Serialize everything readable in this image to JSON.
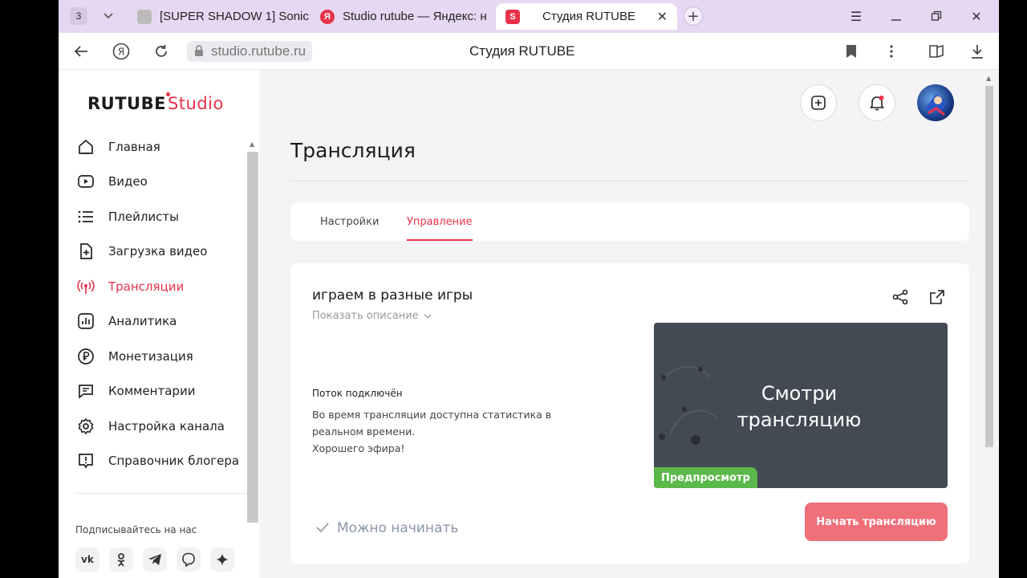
{
  "browser": {
    "tab_count": "3",
    "tabs": [
      {
        "label": "[SUPER SHADOW 1] Sonic"
      },
      {
        "label": "Studio rutube — Яндекс: н"
      },
      {
        "label": "Студия RUTUBE"
      }
    ],
    "url": "studio.rutube.ru",
    "page_title": "Студия RUTUBE"
  },
  "logo": {
    "brand": "RUTUBE",
    "suffix": "Studio"
  },
  "sidebar": {
    "items": [
      {
        "label": "Главная"
      },
      {
        "label": "Видео"
      },
      {
        "label": "Плейлисты"
      },
      {
        "label": "Загрузка видео"
      },
      {
        "label": "Трансляции"
      },
      {
        "label": "Аналитика"
      },
      {
        "label": "Монетизация"
      },
      {
        "label": "Комментарии"
      },
      {
        "label": "Настройка канала"
      },
      {
        "label": "Справочник блогера"
      }
    ],
    "follow_label": "Подписывайтесь на нас",
    "social": [
      "vk",
      "ok",
      "telegram",
      "viber",
      "dzen"
    ]
  },
  "main": {
    "title": "Трансляция",
    "tabs": [
      {
        "label": "Настройки"
      },
      {
        "label": "Управление"
      }
    ],
    "stream": {
      "title": "играем в разные игры",
      "show_description": "Показать описание",
      "status_heading": "Поток подключён",
      "info_line1": "Во время трансляции доступна статистика в",
      "info_line2": "реальном времени.",
      "info_line3": "Хорошего эфира!",
      "preview_line1": "Смотри",
      "preview_line2": "трансляцию",
      "preview_badge": "Предпросмотр",
      "ready_label": "Можно начинать",
      "start_button": "Начать трансляцию"
    }
  },
  "colors": {
    "accent": "#e8334a",
    "start_button": "#f0707a",
    "preview_bg": "#434a54",
    "badge": "#5bb84a"
  }
}
